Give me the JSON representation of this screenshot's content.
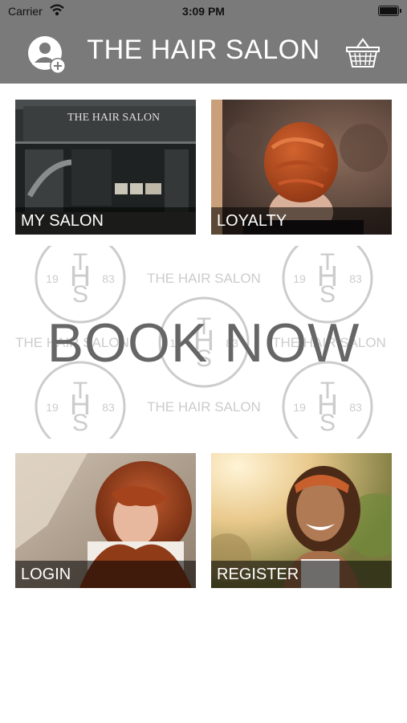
{
  "status_bar": {
    "carrier": "Carrier",
    "time": "3:09 PM"
  },
  "header": {
    "title": "THE HAIR SALON",
    "left_icon": "add-user-icon",
    "right_icon": "basket-icon"
  },
  "tiles": [
    {
      "label": "MY SALON"
    },
    {
      "label": "LOYALTY"
    },
    {
      "label": "LOGIN"
    },
    {
      "label": "REGISTER"
    }
  ],
  "salon_sign": "THE HAIR SALON",
  "book": {
    "label": "BOOK NOW",
    "pattern_text": "THE HAIR SALON",
    "logo_letters": "TS",
    "logo_h": "H",
    "logo_year_left": "19",
    "logo_year_right": "83"
  },
  "colors": {
    "header_bg": "#7a7a7a",
    "caption_bg": "#000000",
    "book_text": "#666666",
    "pattern": "#cccccc"
  }
}
